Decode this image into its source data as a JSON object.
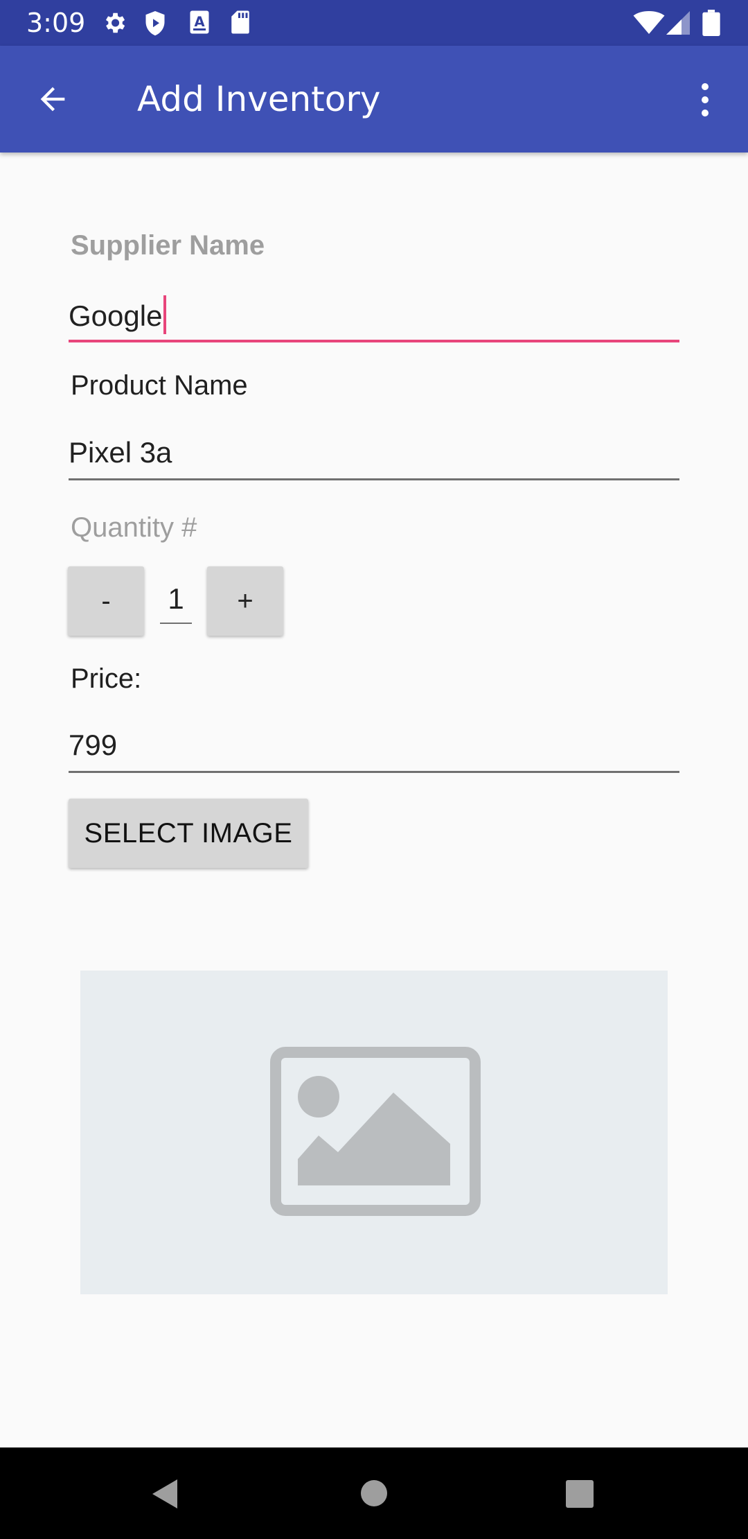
{
  "status_bar": {
    "time": "3:09",
    "left_icons": [
      "gear-icon",
      "shield-play-icon",
      "a-text-icon",
      "sd-card-icon"
    ],
    "right_icons": [
      "wifi-icon",
      "cell-signal-icon",
      "battery-icon"
    ]
  },
  "app_bar": {
    "title": "Add Inventory",
    "back_icon": "arrow-back-icon",
    "menu_icon": "more-vert-icon",
    "color": "#3f51b5",
    "status_color": "#303f9f"
  },
  "form": {
    "supplier": {
      "label": "Supplier Name",
      "value": "Google"
    },
    "product": {
      "label": "Product Name",
      "value": "Pixel 3a"
    },
    "quantity": {
      "label": "Quantity #",
      "decrement_label": "-",
      "value": "1",
      "increment_label": "+"
    },
    "price": {
      "label": "Price:",
      "value": "799"
    },
    "select_image_label": "SELECT IMAGE",
    "accent_color": "#e8457b"
  },
  "image_preview": {
    "icon": "image-placeholder-icon"
  },
  "nav_bar": {
    "icons": [
      "nav-back-icon",
      "nav-home-icon",
      "nav-recents-icon"
    ]
  }
}
